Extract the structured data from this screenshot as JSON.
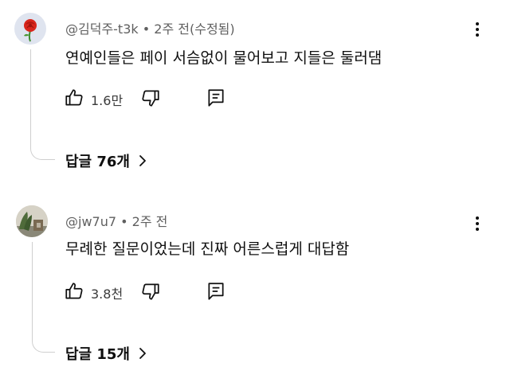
{
  "comments": [
    {
      "author": "@김덕주-t3k",
      "separator": "•",
      "time": "2주 전(수정됨)",
      "text": "연예인들은 페이 서슴없이 물어보고 지들은 둘러댐",
      "like_count": "1.6만",
      "replies_label": "답글 76개",
      "avatar_icon": "rose-icon"
    },
    {
      "author": "@jw7u7",
      "separator": "•",
      "time": "2주 전",
      "text": "무례한 질문이었는데 진짜 어른스럽게 대답함",
      "like_count": "3.8천",
      "replies_label": "답글 15개",
      "avatar_icon": "photo-avatar"
    }
  ],
  "icons": {
    "like": "thumbs-up-icon",
    "dislike": "thumbs-down-icon",
    "reply": "comment-icon",
    "more": "more-vert-icon",
    "expand": "chevron-right-icon"
  },
  "colors": {
    "text": "#0f0f0f",
    "meta": "#606060",
    "thread_line": "#cfcfcf"
  }
}
